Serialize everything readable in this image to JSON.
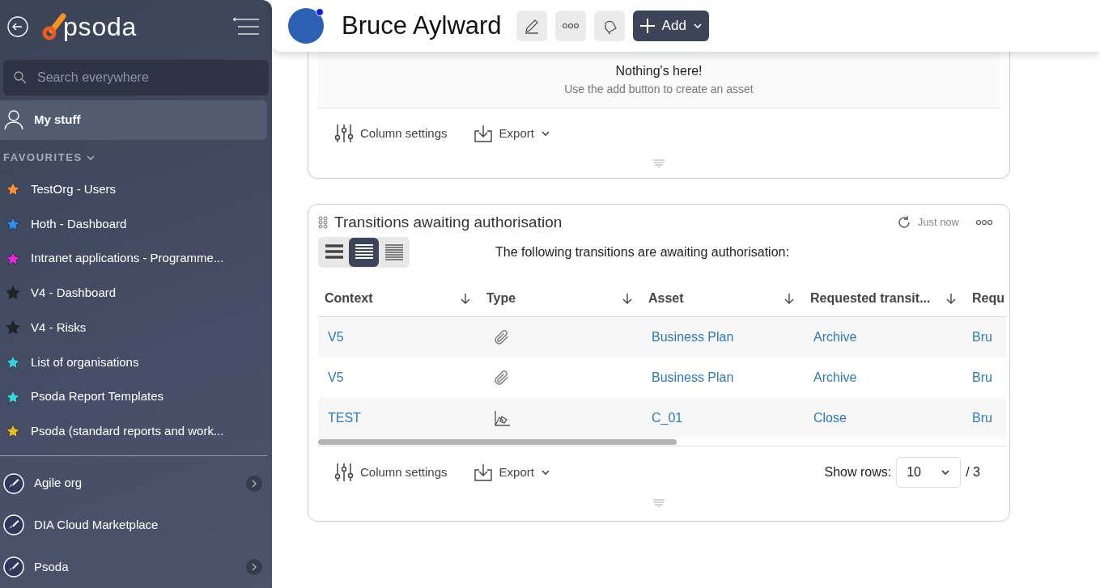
{
  "sidebar": {
    "logo_text": "psoda",
    "search": {
      "placeholder": "Search everywhere"
    },
    "my_stuff": {
      "label": "My stuff",
      "selected": true
    },
    "favourites_heading": "FAVOURITES",
    "favourites": [
      {
        "label": "TestOrg - Users",
        "color": "#f7913d"
      },
      {
        "label": "Hoth - Dashboard",
        "color": "#2f8fe8"
      },
      {
        "label": "Intranet applications - Programme...",
        "color": "#e02ad6"
      },
      {
        "label": "V4 - Dashboard",
        "color": "#222222"
      },
      {
        "label": "V4 - Risks",
        "color": "#222222"
      },
      {
        "label": "List of organisations",
        "color": "#3ccfe0"
      },
      {
        "label": "Psoda Report Templates",
        "color": "#3ccfe0"
      },
      {
        "label": "Psoda (standard reports and work...",
        "color": "#e6bb2a"
      }
    ],
    "organisations": [
      {
        "label": "Agile org",
        "has_children": true
      },
      {
        "label": "DIA Cloud Marketplace",
        "has_children": false
      },
      {
        "label": "Psoda",
        "has_children": true
      }
    ]
  },
  "header": {
    "title": "Bruce Aylward",
    "online": true,
    "add_label": "Add"
  },
  "assets_card": {
    "empty_title": "Nothing's here!",
    "empty_hint": "Use the add button to create an asset",
    "column_settings": "Column settings",
    "export": "Export"
  },
  "transitions_card": {
    "title": "Transitions awaiting authorisation",
    "refreshed": "Just now",
    "description": "The following transitions are awaiting authorisation:",
    "densities": [
      {
        "kind": "large",
        "selected": false
      },
      {
        "kind": "medium",
        "selected": true
      },
      {
        "kind": "small",
        "selected": false
      }
    ],
    "columns": [
      "Context",
      "Type",
      "Asset",
      "Requested transit...",
      "Requ"
    ],
    "rows": [
      {
        "context": "V5",
        "kind": "attachment",
        "asset": "Business Plan",
        "transition": "Archive",
        "column_5": "Bru"
      },
      {
        "context": "V5",
        "kind": "attachment",
        "asset": "Business Plan",
        "transition": "Archive",
        "column_5": "Bru"
      },
      {
        "context": "TEST",
        "kind": "drawing",
        "asset": "C_01",
        "transition": "Close",
        "column_5": "Bru"
      }
    ],
    "column_settings": "Column settings",
    "export": "Export",
    "show_rows_label": "Show rows:",
    "show_rows_value": "10",
    "page_total": "/ 3"
  }
}
